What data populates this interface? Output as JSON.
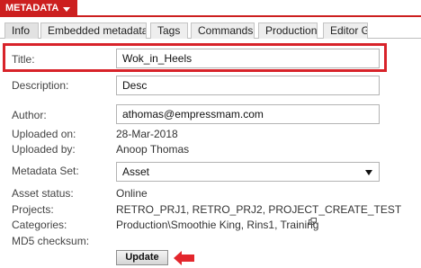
{
  "header": {
    "title": "METADATA"
  },
  "tabs": [
    {
      "label": "Info",
      "active": true
    },
    {
      "label": "Embedded metadata",
      "active": false
    },
    {
      "label": "Tags",
      "active": false
    },
    {
      "label": "Commands",
      "active": false
    },
    {
      "label": "Production",
      "active": false
    },
    {
      "label": "Editor G",
      "active": false
    }
  ],
  "form": {
    "title_label": "Title:",
    "title_value": "Wok_in_Heels",
    "description_label": "Description:",
    "description_value": "Desc",
    "author_label": "Author:",
    "author_value": "athomas@empressmam.com",
    "uploaded_on_label": "Uploaded on:",
    "uploaded_on_value": "28-Mar-2018",
    "uploaded_by_label": "Uploaded by:",
    "uploaded_by_value": "Anoop Thomas",
    "metadata_set_label": "Metadata Set:",
    "metadata_set_value": "Asset",
    "asset_status_label": "Asset status:",
    "asset_status_value": "Online",
    "projects_label": "Projects:",
    "projects_value": "RETRO_PRJ1, RETRO_PRJ2, PROJECT_CREATE_TEST",
    "categories_label": "Categories:",
    "categories_value": "Production\\Smoothie King, Rins1, Training",
    "md5_label": "MD5 checksum:",
    "update_label": "Update"
  },
  "colors": {
    "accent": "#cc1f1f",
    "highlight": "#d8232a"
  },
  "icons": {
    "header_caret": "caret-down-icon",
    "external_link": "external-link-icon",
    "annotation_arrow": "arrow-left-icon"
  }
}
